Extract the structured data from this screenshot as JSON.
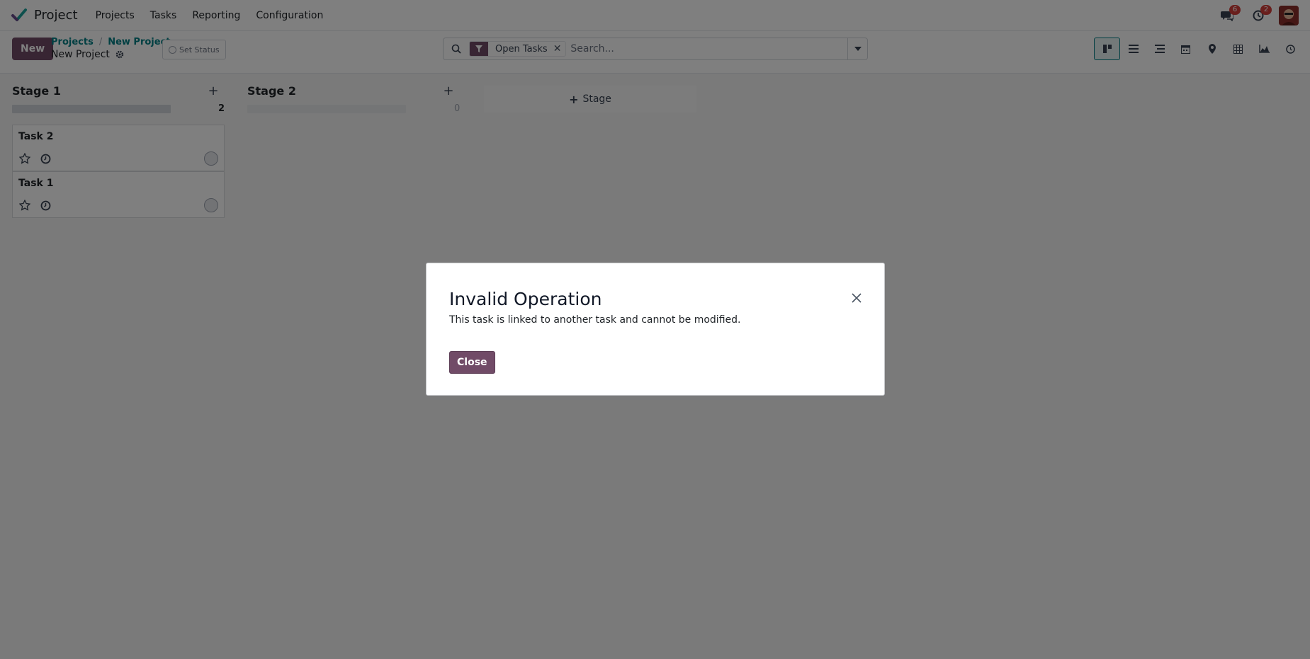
{
  "app": {
    "name": "Project"
  },
  "menu": [
    "Projects",
    "Tasks",
    "Reporting",
    "Configuration"
  ],
  "systray": {
    "messages_count": "6",
    "activities_count": "2"
  },
  "control": {
    "new_label": "New",
    "breadcrumb": [
      "Projects",
      "New Project"
    ],
    "breadcrumb_sep": "/",
    "current_title": "New Project",
    "set_status_label": "Set Status"
  },
  "search": {
    "facet_label": "Open Tasks",
    "facet_remove": "✕",
    "placeholder": "Search..."
  },
  "views": [
    "kanban-icon",
    "list-icon",
    "activity-list-icon",
    "calendar-icon",
    "map-icon",
    "pivot-icon",
    "graph-icon",
    "clock-icon"
  ],
  "kanban": {
    "columns": [
      {
        "title": "Stage 1",
        "count": "2",
        "tasks": [
          "Task 2",
          "Task 1"
        ]
      },
      {
        "title": "Stage 2",
        "count": "0",
        "tasks": []
      }
    ],
    "add_stage_label": "Stage"
  },
  "dialog": {
    "title": "Invalid Operation",
    "message": "This task is linked to another task and cannot be modified.",
    "close_label": "Close"
  },
  "colors": {
    "brand": "#714b67",
    "link": "#017e84",
    "badge": "#d23f3a"
  }
}
